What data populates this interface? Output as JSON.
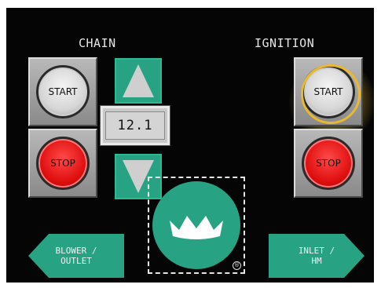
{
  "chain": {
    "title": "CHAIN",
    "start_label": "START",
    "stop_label": "STOP",
    "value": "12.1"
  },
  "ignition": {
    "title": "IGNITION",
    "start_label": "START",
    "stop_label": "STOP"
  },
  "nav": {
    "left_line1": "BLOWER /",
    "left_line2": "OUTLET",
    "right_line1": "INLET /",
    "right_line2": "HM"
  },
  "logo": {
    "registered_mark": "®",
    "icon": "crown-icon"
  },
  "colors": {
    "panel": "#050505",
    "teal": "#27a383",
    "highlight": "#e8b830",
    "stop_red": "#e01010",
    "start_gray": "#d6d6d6"
  }
}
